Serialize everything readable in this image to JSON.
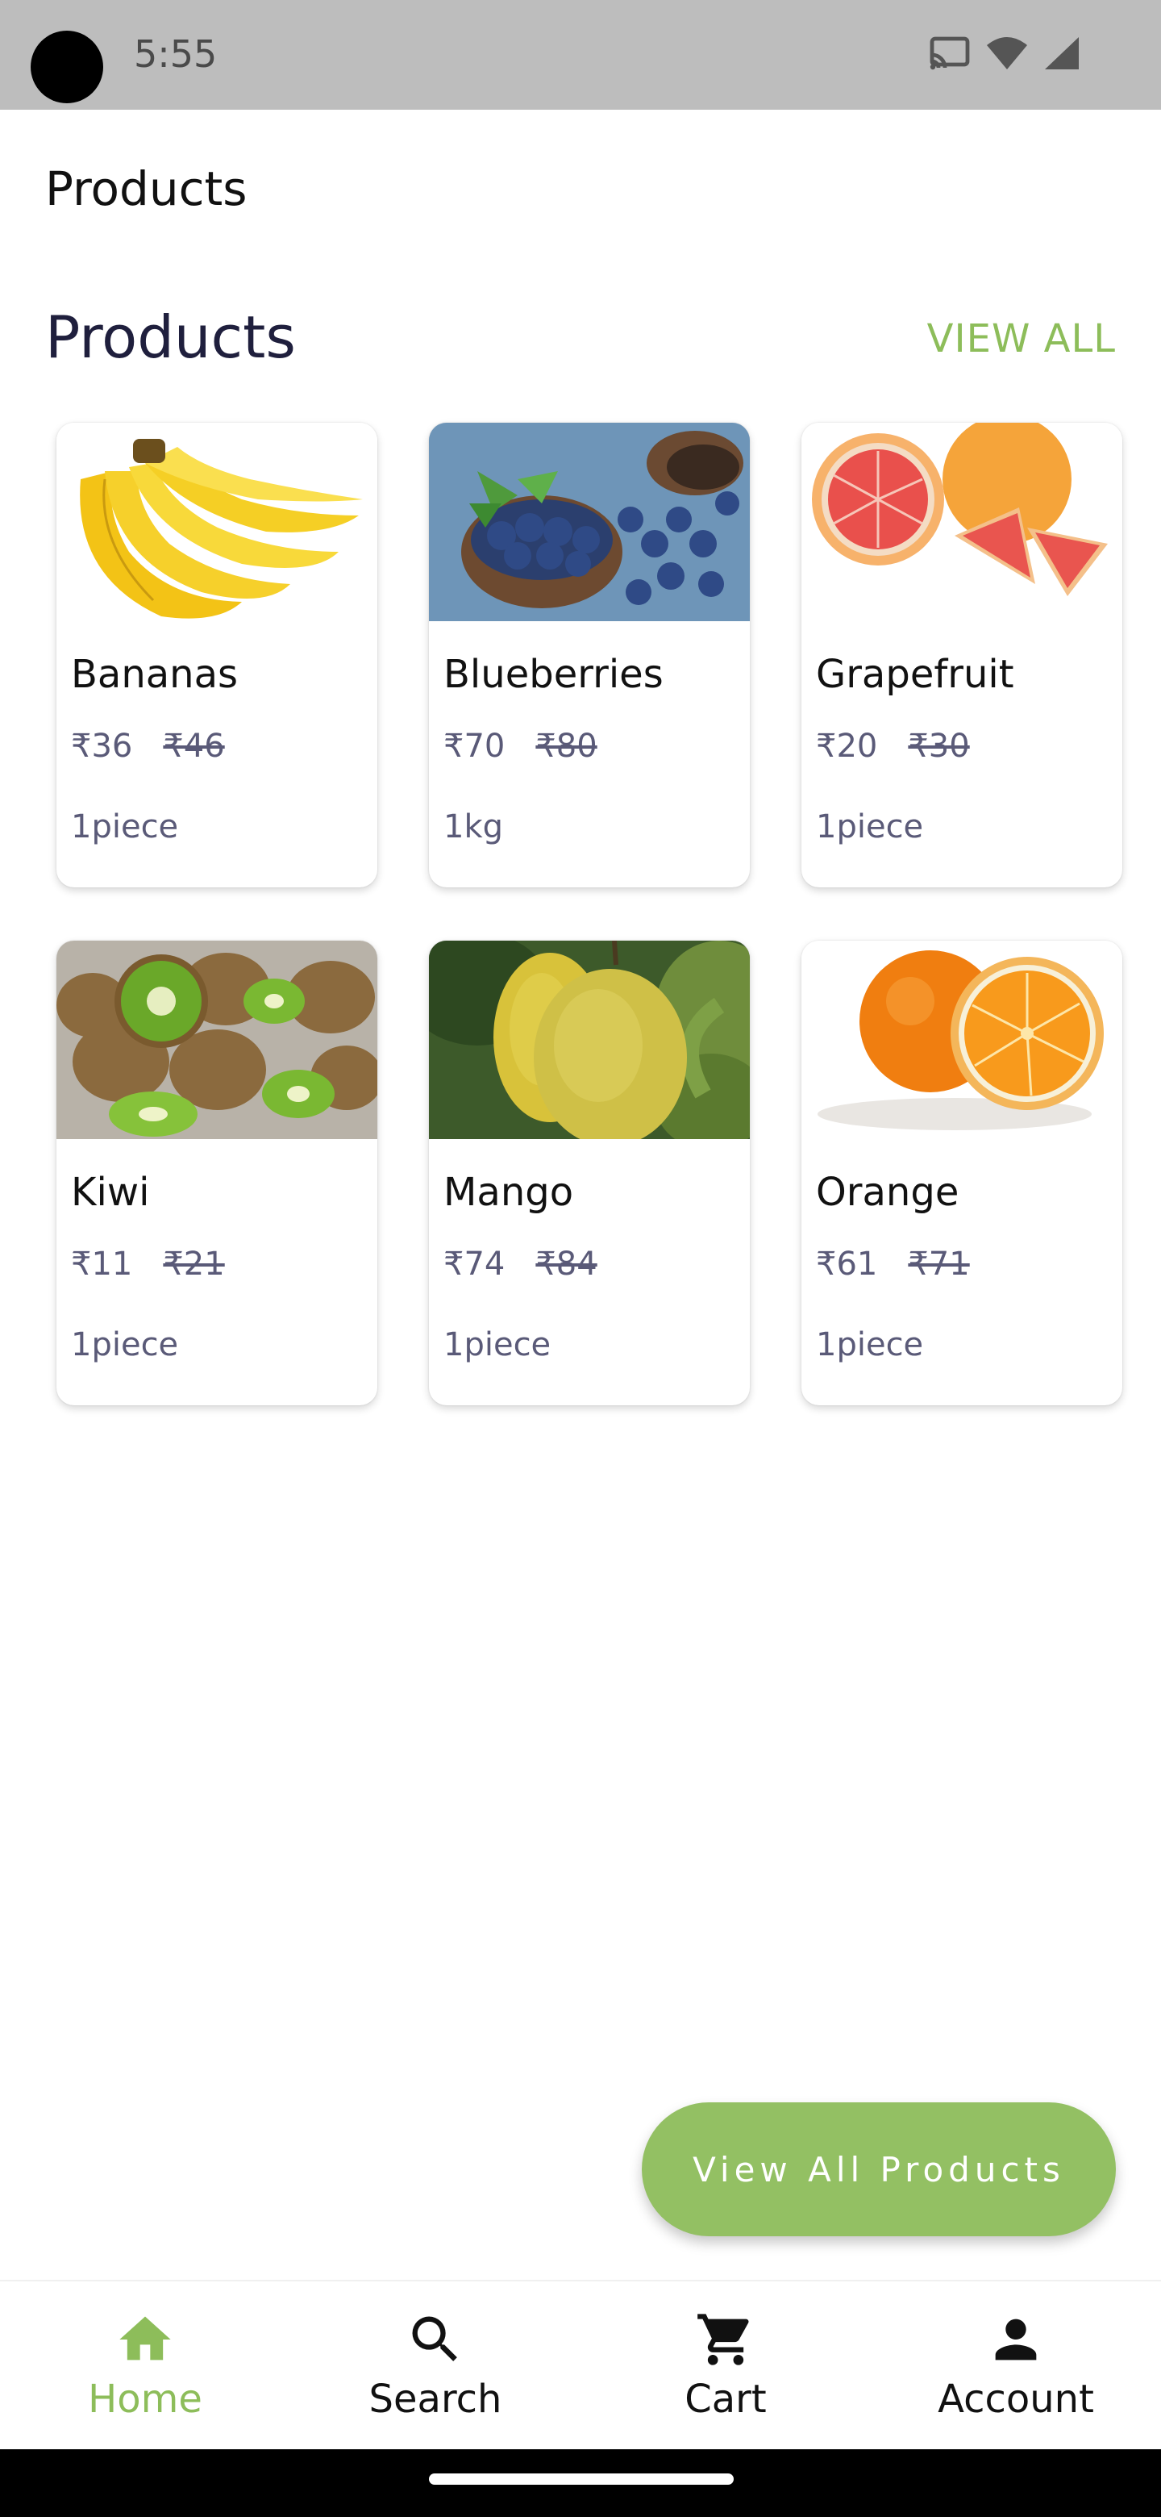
{
  "status_bar": {
    "time": "5:55",
    "icons": [
      "cast-icon",
      "wifi-icon",
      "signal-icon"
    ]
  },
  "app_bar": {
    "title": "Products"
  },
  "section": {
    "title": "Products",
    "view_all_label": "VIEW ALL"
  },
  "products": [
    {
      "name": "Bananas",
      "price": "₹36",
      "old_price": "₹46",
      "unit": "1piece",
      "image": "bananas"
    },
    {
      "name": "Blueberries",
      "price": "₹70",
      "old_price": "₹80",
      "unit": "1kg",
      "image": "blueberries"
    },
    {
      "name": "Grapefruit",
      "price": "₹20",
      "old_price": "₹30",
      "unit": "1piece",
      "image": "grapefruit"
    },
    {
      "name": "Kiwi",
      "price": "₹11",
      "old_price": "₹21",
      "unit": "1piece",
      "image": "kiwi"
    },
    {
      "name": "Mango",
      "price": "₹74",
      "old_price": "₹84",
      "unit": "1piece",
      "image": "mango"
    },
    {
      "name": "Orange",
      "price": "₹61",
      "old_price": "₹71",
      "unit": "1piece",
      "image": "orange"
    }
  ],
  "fab": {
    "label": "View All Products"
  },
  "bottom_nav": {
    "items": [
      {
        "label": "Home",
        "icon": "home-icon",
        "active": true
      },
      {
        "label": "Search",
        "icon": "search-icon",
        "active": false
      },
      {
        "label": "Cart",
        "icon": "cart-icon",
        "active": false
      },
      {
        "label": "Account",
        "icon": "account-icon",
        "active": false
      }
    ]
  },
  "colors": {
    "accent": "#8dbd5a",
    "fab": "#93c063",
    "title": "#1f1f3d",
    "muted": "#5a5a78"
  }
}
